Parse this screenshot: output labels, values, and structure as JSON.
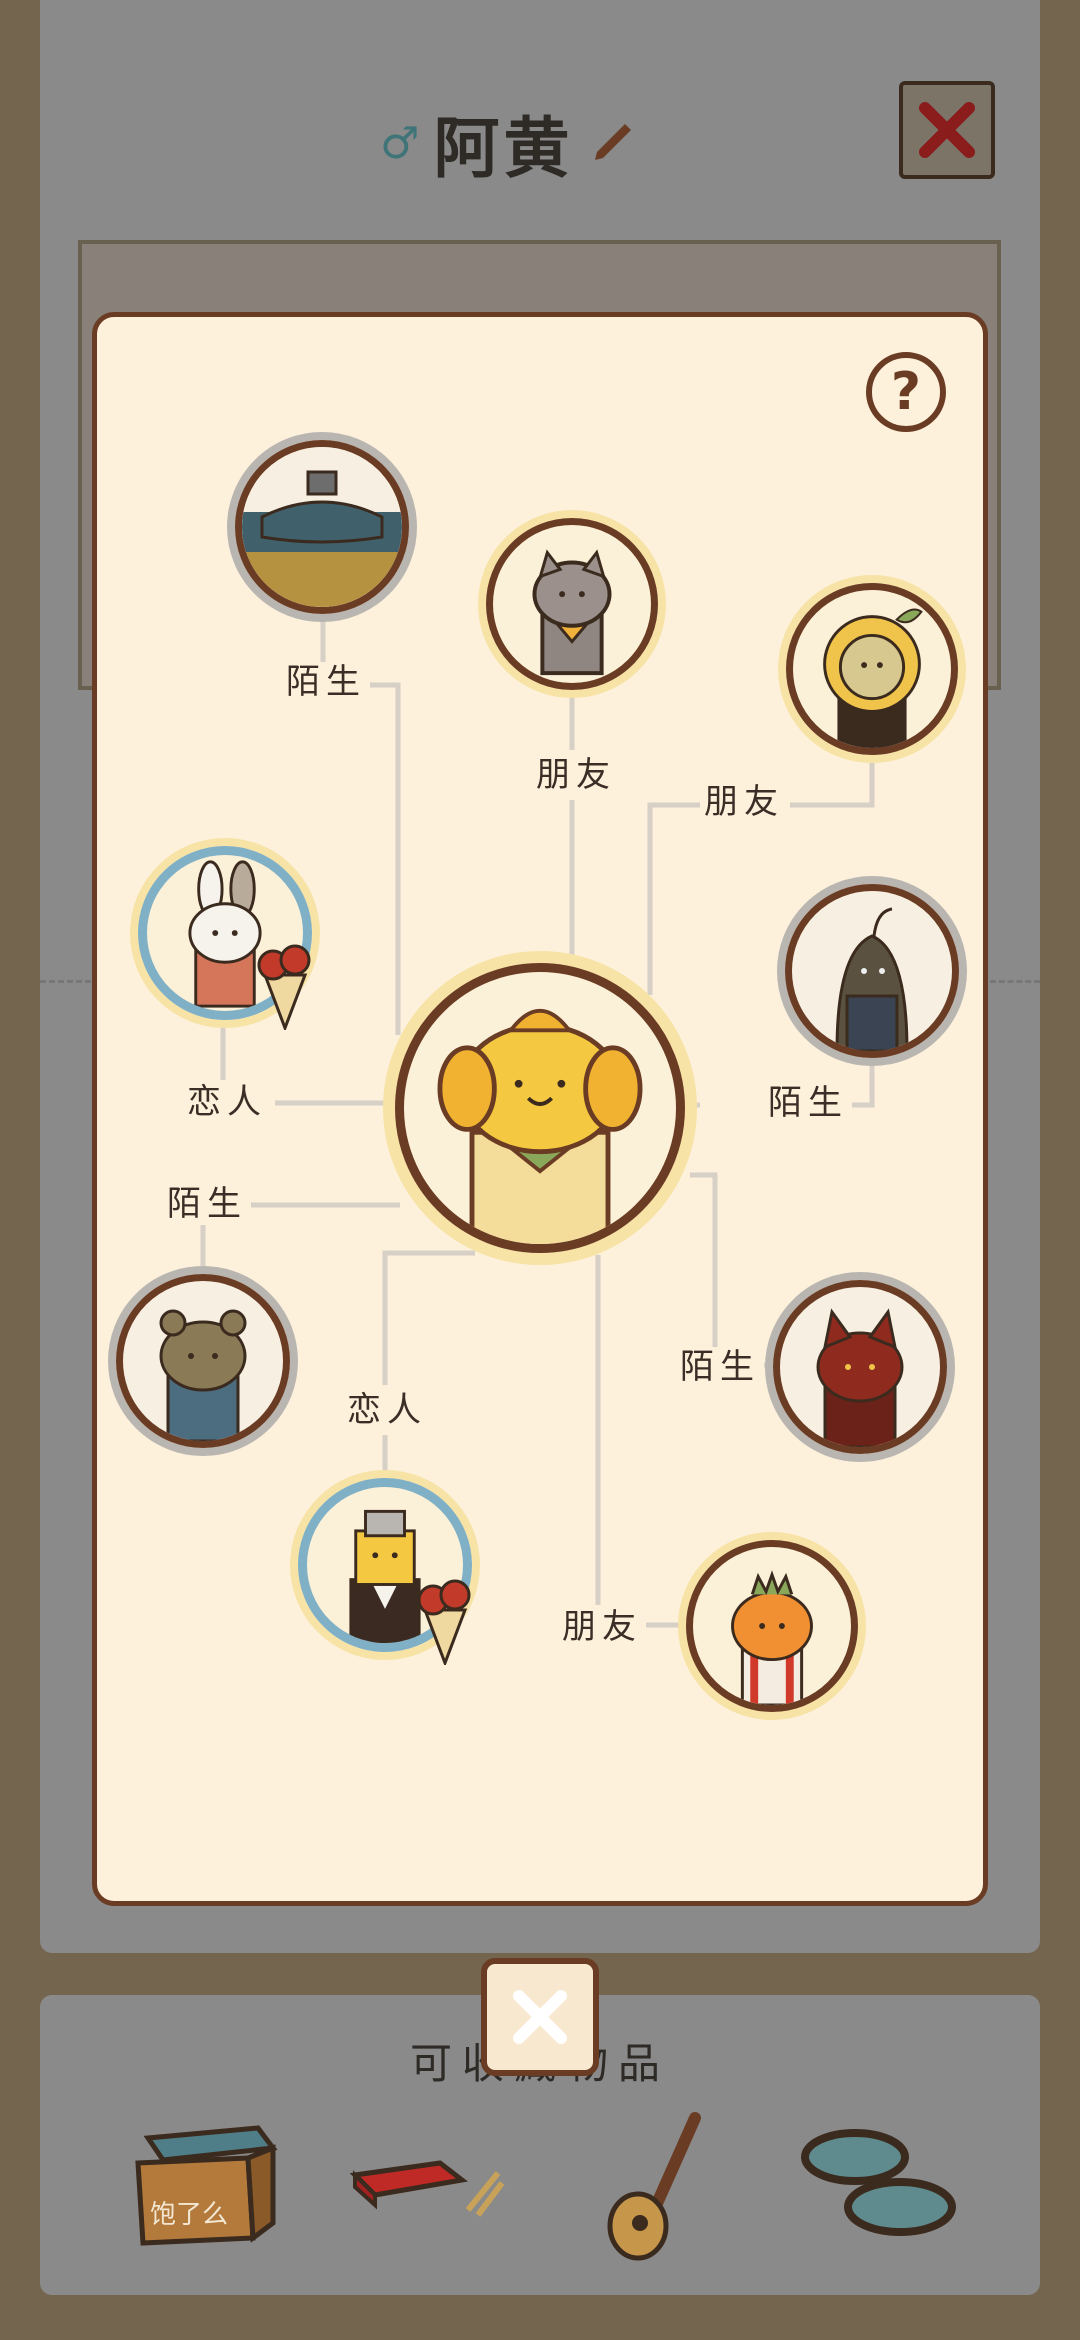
{
  "profile": {
    "gender_icon": "male-icon",
    "name": "阿黄",
    "edit_icon": "pencil-icon",
    "close_icon": "close-icon"
  },
  "inventory": {
    "title": "可收藏物品",
    "items": [
      "cardboard-box-icon",
      "mahjong-box-icon",
      "guitar-icon",
      "slippers-icon"
    ],
    "box_text": "饱了么"
  },
  "relationship": {
    "help_icon": "question-icon",
    "center": {
      "avatar": "yellow-dog-avatar"
    },
    "nodes": [
      {
        "id": "robot-boat",
        "label": "陌生",
        "ring": "gray"
      },
      {
        "id": "raccoon",
        "label": "朋友",
        "ring": "gold"
      },
      {
        "id": "sunflower",
        "label": "朋友",
        "ring": "gold"
      },
      {
        "id": "bunny",
        "label": "恋人",
        "ring": "gold",
        "bouquet": true
      },
      {
        "id": "sprout-suit",
        "label": "陌生",
        "ring": "gray"
      },
      {
        "id": "brown-bear",
        "label": "陌生",
        "ring": "gray"
      },
      {
        "id": "red-fox",
        "label": "陌生",
        "ring": "gray"
      },
      {
        "id": "robot-suit",
        "label": "恋人",
        "ring": "gold",
        "bouquet": true
      },
      {
        "id": "orange-carrot",
        "label": "朋友",
        "ring": "gold"
      }
    ]
  },
  "dialog_close_icon": "close-icon",
  "colors": {
    "dialog_bg": "#fdf1dc",
    "border_brown": "#6b3c24",
    "ring_gray": "#b9b5b0",
    "ring_gold": "#f7e3a6",
    "ring_blue": "#7fb0c6",
    "connector": "#d6d0c6"
  }
}
